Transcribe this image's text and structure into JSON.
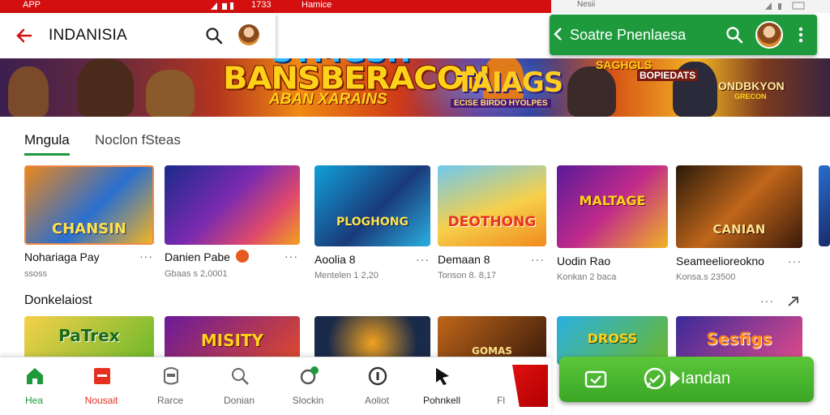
{
  "status_bar": {
    "app": "APP",
    "time": "1733",
    "name": "Hamice"
  },
  "search_bar": {
    "title": "INDANISIA"
  },
  "right_status": {
    "text": "Nesii"
  },
  "green_bar": {
    "title": "Soatre Pnenlaesa"
  },
  "banner": {
    "hero_top": "STMGSH",
    "hero_title": "BANSBERACON",
    "hero_sub": "ABAN XARAINS",
    "mid_title": "TAIAGS",
    "mid_sub": "ECISE BIRDO HYOLPES",
    "right_title": "SAGHGLS",
    "right_box": "BOPIEDATS",
    "right_logo": "ONDBKYON",
    "right_logo_sub": "GRECON"
  },
  "tabs": [
    {
      "label": "Mngula"
    },
    {
      "label": "Noclon fSteas"
    }
  ],
  "row1": [
    {
      "title": "Nohariaga Pay",
      "sub": "ssoss",
      "thumb_text": "CHANSIN"
    },
    {
      "title": "Danien Pabe",
      "sub": "Gbaas s 2,0001",
      "thumb_text": ""
    },
    {
      "title": "Aoolia 8",
      "sub": "Mentelen 1 2,20",
      "thumb_text": "PLOGHONG"
    },
    {
      "title": "Demaan 8",
      "sub": "Tonson 8. 8,17",
      "thumb_text": "DEOTHONG"
    },
    {
      "title": "Uodin Rao",
      "sub": "Konkan 2 baca",
      "thumb_text": "MALTAGE"
    },
    {
      "title": "Seameelioreokno",
      "sub": "Konsa.s 23500",
      "thumb_text": "CANIAN"
    }
  ],
  "section2": {
    "title": "Donkelaiost"
  },
  "row2": [
    {
      "thumb_text": "PaTrex"
    },
    {
      "thumb_text": "MISITY"
    },
    {
      "thumb_text": ""
    },
    {
      "thumb_text": "GOMAS"
    },
    {
      "thumb_text": "DROSS"
    },
    {
      "thumb_text": "Sesfigs"
    }
  ],
  "bottom_nav": [
    {
      "label": "Hea"
    },
    {
      "label": "Nousait"
    },
    {
      "label": "Rarce"
    },
    {
      "label": "Donian"
    },
    {
      "label": "Slockin"
    },
    {
      "label": "Aoliot"
    },
    {
      "label": "Pohnkell"
    },
    {
      "label": "Fl"
    }
  ],
  "install_button": {
    "label": "Iandan"
  },
  "colors": {
    "brand_red": "#d40f0f",
    "brand_green": "#1e9a3c",
    "active_nav": "#e53020"
  }
}
